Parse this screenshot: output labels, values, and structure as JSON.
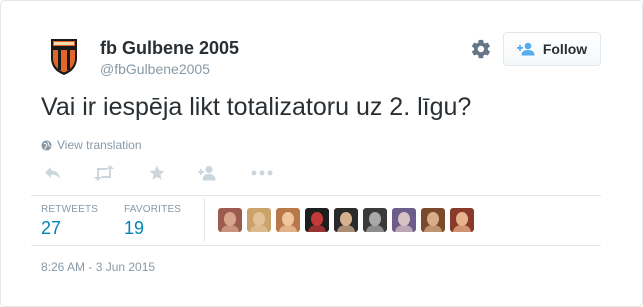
{
  "colors": {
    "accent": "#0084b4",
    "muted": "#8899a6",
    "text": "#292f33",
    "border": "#e1e8ed"
  },
  "header": {
    "name": "fb Gulbene 2005",
    "handle": "@fbGulbene2005",
    "follow_label": "Follow",
    "icons": [
      "gear-icon",
      "add-user-icon"
    ]
  },
  "tweet": {
    "text": "Vai ir iespēja likt totalizatoru uz 2. līgu?",
    "translate_label": "View translation"
  },
  "actions": [
    "reply-icon",
    "retweet-icon",
    "favorite-icon",
    "follow-icon",
    "more-icon"
  ],
  "stats": {
    "retweets_label": "RETWEETS",
    "retweets_value": "27",
    "favorites_label": "FAVORITES",
    "favorites_value": "19"
  },
  "faces": [
    {
      "bg": "#9b5b4f",
      "skin": "#d9a58c"
    },
    {
      "bg": "#c9a36a",
      "skin": "#e3c29a"
    },
    {
      "bg": "#b7794a",
      "skin": "#f0c49c"
    },
    {
      "bg": "#1e1e1e",
      "skin": "#c43a3a"
    },
    {
      "bg": "#2a2a2a",
      "skin": "#d7b08e"
    },
    {
      "bg": "#3a3a3a",
      "skin": "#a9a9a9"
    },
    {
      "bg": "#6b5c8a",
      "skin": "#d6c2c2"
    },
    {
      "bg": "#7a4a2c",
      "skin": "#d9ad88"
    },
    {
      "bg": "#8a3a2a",
      "skin": "#e7b28c"
    }
  ],
  "timestamp": "8:26 AM - 3 Jun 2015"
}
